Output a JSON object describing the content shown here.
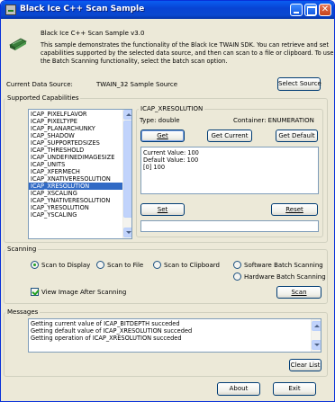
{
  "window": {
    "title": "Black Ice C++ Scan Sample"
  },
  "header": {
    "version": "Black Ice C++ Scan Sample v3.0",
    "description_lines": [
      "This sample demonstrates the functionality of the Black Ice TWAIN SDK. You can retrieve and set",
      "capabilities supported by the selected data source, and then can scan to a file or clipboard. To use",
      "the Batch Scanning functionality, select the batch scan option."
    ]
  },
  "data_source": {
    "label": "Current Data Source:",
    "value": "TWAIN_32 Sample Source",
    "select_button": "Select Source"
  },
  "capabilities": {
    "group_label": "Supported Capabilities",
    "items": [
      "ICAP_PIXELFLAVOR",
      "ICAP_PIXELTYPE",
      "ICAP_PLANARCHUNKY",
      "ICAP_SHADOW",
      "ICAP_SUPPORTEDSIZES",
      "ICAP_THRESHOLD",
      "ICAP_UNDEFINEDIMAGESIZE",
      "ICAP_UNITS",
      "ICAP_XFERMECH",
      "ICAP_XNATIVERESOLUTION",
      "ICAP_XRESOLUTION",
      "ICAP_XSCALING",
      "ICAP_YNATIVERESOLUTION",
      "ICAP_YRESOLUTION",
      "ICAP_YSCALING"
    ],
    "selected": "ICAP_XRESOLUTION",
    "detail": {
      "name": "ICAP_XRESOLUTION",
      "type": "Type: double",
      "container": "Container:  ENUMERATION",
      "get_button": "Get",
      "get_current_button": "Get Current",
      "get_default_button": "Get Default",
      "values": [
        "Current Value: 100",
        "Default Value: 100",
        "[0] 100"
      ],
      "set_button": "Set",
      "reset_button": "Reset",
      "set_value": ""
    }
  },
  "scanning": {
    "group_label": "Scanning",
    "options": [
      {
        "label": "Scan to Display",
        "checked": true
      },
      {
        "label": "Scan to File",
        "checked": false
      },
      {
        "label": "Scan to Clipboard",
        "checked": false
      },
      {
        "label": "Software Batch Scanning",
        "checked": false
      },
      {
        "label": "Hardware Batch Scanning",
        "checked": false
      }
    ],
    "view_image_label": "View Image After Scanning",
    "view_image_checked": true,
    "scan_button": "Scan"
  },
  "messages": {
    "group_label": "Messages",
    "lines": [
      "Getting current value of ICAP_BITDEPTH succeded",
      "Getting default value of ICAP_XRESOLUTION succeded",
      "Getting operation of ICAP_XRESOLUTION succeded"
    ],
    "clear_button": "Clear List"
  },
  "footer": {
    "about_button": "About",
    "exit_button": "Exit"
  },
  "colors": {
    "titlebar": "#0a5ef2",
    "selection": "#316ac5",
    "face": "#ece9d8"
  }
}
